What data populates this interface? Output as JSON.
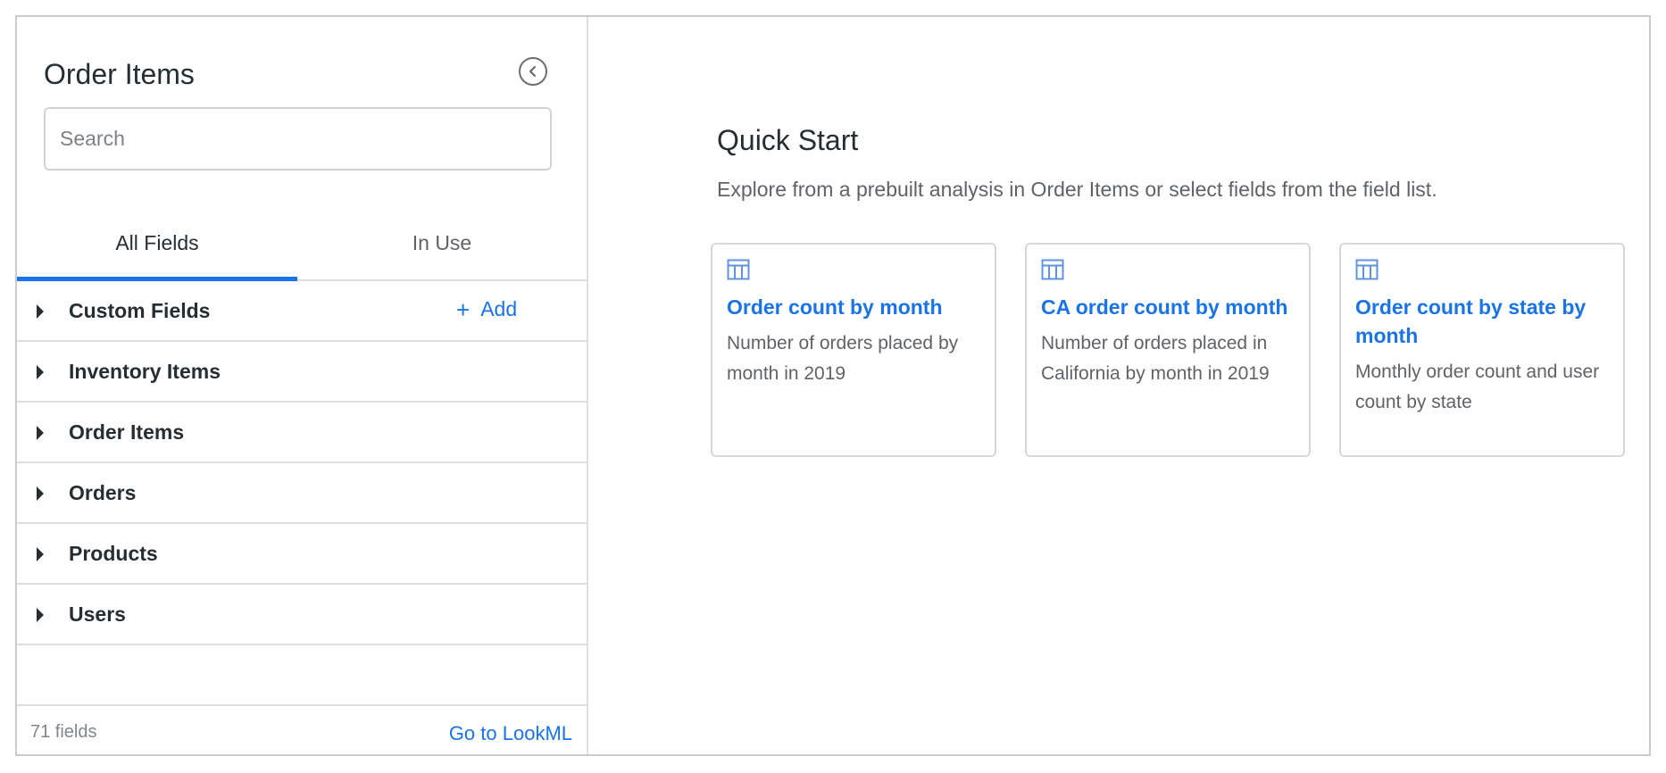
{
  "sidebar": {
    "title": "Order Items",
    "search": {
      "placeholder": "Search",
      "value": ""
    },
    "tabs": [
      {
        "label": "All Fields",
        "active": true
      },
      {
        "label": "In Use",
        "active": false
      }
    ],
    "groups": [
      {
        "label": "Custom Fields",
        "action_label": "Add",
        "action_icon": "plus-icon"
      },
      {
        "label": "Inventory Items"
      },
      {
        "label": "Order Items"
      },
      {
        "label": "Orders"
      },
      {
        "label": "Products"
      },
      {
        "label": "Users"
      }
    ],
    "footer": {
      "count": "71 fields",
      "link": "Go to LookML"
    },
    "collapse_icon": "chevron-left-circle-icon"
  },
  "quick_start": {
    "title": "Quick Start",
    "subtitle": "Explore from a prebuilt analysis in Order Items or select fields from the field list.",
    "cards": [
      {
        "icon": "table-icon",
        "title": "Order count by month",
        "description": "Number of orders placed by month in 2019"
      },
      {
        "icon": "table-icon",
        "title": "CA order count by month",
        "description": "Number of orders placed in California by month in 2019"
      },
      {
        "icon": "table-icon",
        "title": "Order count by state by month",
        "description": "Monthly order count and user count by state"
      }
    ]
  },
  "colors": {
    "accent": "#1a73e8",
    "text": "#262d33",
    "muted": "#5f6368",
    "border": "#dcdfe3"
  }
}
